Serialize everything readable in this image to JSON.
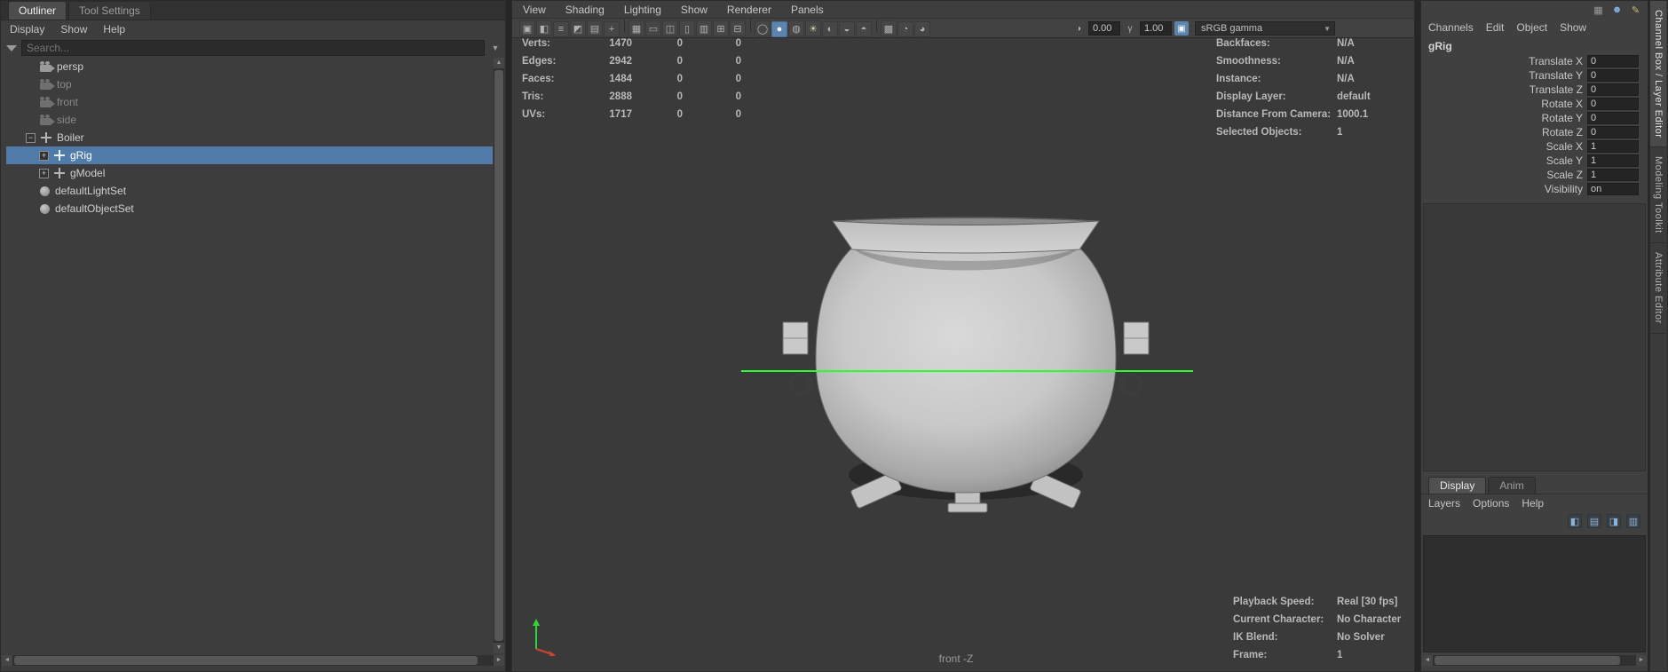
{
  "colors": {
    "selection_blue": "#507aa7",
    "hud_green": "#2eff2e",
    "active_icon_blue": "#5c84ad"
  },
  "outliner": {
    "tabs": [
      {
        "label": "Outliner"
      },
      {
        "label": "Tool Settings"
      }
    ],
    "menus": [
      "Display",
      "Show",
      "Help"
    ],
    "search_placeholder": "Search...",
    "items": [
      {
        "label": "persp",
        "icon": "camera-icon"
      },
      {
        "label": "top",
        "icon": "camera-icon"
      },
      {
        "label": "front",
        "icon": "camera-icon"
      },
      {
        "label": "side",
        "icon": "camera-icon"
      },
      {
        "label": "Boiler",
        "icon": "transform-node-icon",
        "expander": "−"
      },
      {
        "label": "gRig",
        "icon": "transform-node-icon",
        "expander": "+",
        "selected": true
      },
      {
        "label": "gModel",
        "icon": "transform-node-icon",
        "expander": "+"
      },
      {
        "label": "defaultLightSet",
        "icon": "set-icon"
      },
      {
        "label": "defaultObjectSet",
        "icon": "set-icon"
      }
    ]
  },
  "viewport": {
    "menus": [
      "View",
      "Shading",
      "Lighting",
      "Show",
      "Renderer",
      "Panels"
    ],
    "toolbar": {
      "icons": [
        {
          "name": "select-camera-icon",
          "glyph": "▣"
        },
        {
          "name": "lock-camera-icon",
          "glyph": "◧"
        },
        {
          "name": "camera-attributes-icon",
          "glyph": "≡"
        },
        {
          "name": "bookmarks-icon",
          "glyph": "◩"
        },
        {
          "name": "image-plane-icon",
          "glyph": "▤"
        },
        {
          "name": "pan-zoom-icon",
          "glyph": "+"
        },
        {
          "sep": true
        },
        {
          "name": "grid-icon",
          "glyph": "▦"
        },
        {
          "name": "film-gate-icon",
          "glyph": "▭"
        },
        {
          "name": "resolution-gate-icon",
          "glyph": "◫"
        },
        {
          "name": "gate-mask-icon",
          "glyph": "▯"
        },
        {
          "name": "field-chart-icon",
          "glyph": "▥"
        },
        {
          "name": "safe-action-icon",
          "glyph": "⊞"
        },
        {
          "name": "safe-title-icon",
          "glyph": "⊟"
        },
        {
          "sep": true
        },
        {
          "name": "wireframe-icon",
          "glyph": "◯"
        },
        {
          "name": "smooth-shade-icon",
          "glyph": "●",
          "active": true
        },
        {
          "name": "textured-icon",
          "glyph": "◍"
        },
        {
          "name": "use-all-lights-icon",
          "glyph": "☀",
          "tint": "#cfc9a6"
        },
        {
          "name": "shadows-icon",
          "glyph": "◐"
        },
        {
          "name": "screen-space-ao-icon",
          "glyph": "◒"
        },
        {
          "name": "motion-blur-icon",
          "glyph": "◓"
        },
        {
          "sep": true
        },
        {
          "name": "multisample-icon",
          "glyph": "▩"
        },
        {
          "name": "xray-icon",
          "glyph": "◔"
        },
        {
          "name": "isolate-select-icon",
          "glyph": "◕"
        }
      ],
      "exposure": "0.00",
      "gamma": "1.00",
      "color_management_preset": "sRGB gamma"
    },
    "hud_left": [
      {
        "label": "Verts:",
        "v1": "1470",
        "v2": "0",
        "v3": "0"
      },
      {
        "label": "Edges:",
        "v1": "2942",
        "v2": "0",
        "v3": "0"
      },
      {
        "label": "Faces:",
        "v1": "1484",
        "v2": "0",
        "v3": "0"
      },
      {
        "label": "Tris:",
        "v1": "2888",
        "v2": "0",
        "v3": "0"
      },
      {
        "label": "UVs:",
        "v1": "1717",
        "v2": "0",
        "v3": "0"
      }
    ],
    "hud_right": [
      {
        "label": "Backfaces:",
        "value": "N/A"
      },
      {
        "label": "Smoothness:",
        "value": "N/A"
      },
      {
        "label": "Instance:",
        "value": "N/A"
      },
      {
        "label": "Display Layer:",
        "value": "default"
      },
      {
        "label": "Distance From Camera:",
        "value": "1000.1"
      },
      {
        "label": "Selected Objects:",
        "value": "1"
      }
    ],
    "hud_bottom": [
      {
        "label": "Playback Speed:",
        "value": "Real [30 fps]"
      },
      {
        "label": "Current Character:",
        "value": "No Character"
      },
      {
        "label": "IK Blend:",
        "value": "No Solver"
      },
      {
        "label": "Frame:",
        "value": "1"
      }
    ],
    "camera_label": "front -Z"
  },
  "channel_box": {
    "header_icons": [
      {
        "name": "layout-grid-icon",
        "glyph": "▦",
        "tint": "#9a9a9a"
      },
      {
        "name": "user-icon",
        "glyph": "☻",
        "tint": "#7fb2e5"
      },
      {
        "name": "pencil-icon",
        "glyph": "✎",
        "tint": "#cdbd6a"
      }
    ],
    "menus": [
      "Channels",
      "Edit",
      "Object",
      "Show"
    ],
    "node": "gRig",
    "attributes": [
      {
        "label": "Translate X",
        "value": "0"
      },
      {
        "label": "Translate Y",
        "value": "0"
      },
      {
        "label": "Translate Z",
        "value": "0"
      },
      {
        "label": "Rotate X",
        "value": "0"
      },
      {
        "label": "Rotate Y",
        "value": "0"
      },
      {
        "label": "Rotate Z",
        "value": "0"
      },
      {
        "label": "Scale X",
        "value": "1"
      },
      {
        "label": "Scale Y",
        "value": "1"
      },
      {
        "label": "Scale Z",
        "value": "1"
      },
      {
        "label": "Visibility",
        "value": "on"
      }
    ]
  },
  "layer_editor": {
    "tabs": [
      {
        "label": "Display"
      },
      {
        "label": "Anim"
      }
    ],
    "menus": [
      "Layers",
      "Options",
      "Help"
    ],
    "icons": [
      {
        "name": "toggle-layers-icon",
        "glyph": "◧"
      },
      {
        "name": "new-empty-layer-icon",
        "glyph": "▤"
      },
      {
        "name": "new-layer-from-selected-icon",
        "glyph": "◨"
      },
      {
        "name": "layer-options-icon",
        "glyph": "▥"
      }
    ]
  },
  "right_strip": {
    "tabs": [
      "Channel Box / Layer Editor",
      "Modeling Toolkit",
      "Attribute Editor"
    ]
  }
}
